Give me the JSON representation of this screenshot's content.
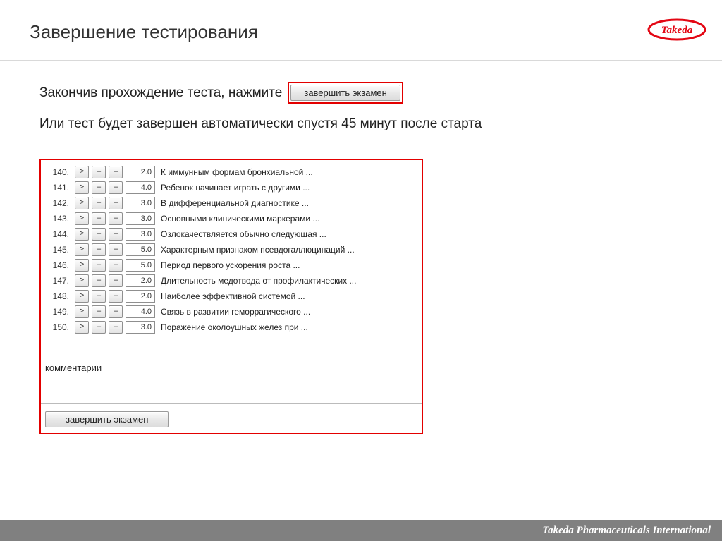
{
  "header": {
    "title": "Завершение тестирования",
    "logo_text": "Takeda",
    "logo_color": "#e30613"
  },
  "intro": {
    "line1_prefix": "Закончив прохождение теста, нажмите",
    "button_label": "завершить экзамен",
    "line2": "Или тест будет завершен автоматически спустя 45 минут после старта"
  },
  "questions": [
    {
      "num": "140.",
      "score": "2.0",
      "text": "К иммунным формам бронхиальной ..."
    },
    {
      "num": "141.",
      "score": "4.0",
      "text": "Ребенок начинает играть с другими ..."
    },
    {
      "num": "142.",
      "score": "3.0",
      "text": "В дифференциальной диагностике ..."
    },
    {
      "num": "143.",
      "score": "3.0",
      "text": "Основными клиническими маркерами ..."
    },
    {
      "num": "144.",
      "score": "3.0",
      "text": "Озлокачествляется обычно следующая ..."
    },
    {
      "num": "145.",
      "score": "5.0",
      "text": "Характерным признаком псевдогаллюцинаций ..."
    },
    {
      "num": "146.",
      "score": "5.0",
      "text": "Период первого ускорения роста ..."
    },
    {
      "num": "147.",
      "score": "2.0",
      "text": "Длительность медотвода от профилактических ..."
    },
    {
      "num": "148.",
      "score": "2.0",
      "text": "Наиболее эффективной системой ..."
    },
    {
      "num": "149.",
      "score": "4.0",
      "text": "Связь в развитии геморрагического ..."
    },
    {
      "num": "150.",
      "score": "3.0",
      "text": "Поражение околоушных желез при ..."
    }
  ],
  "symbols": {
    "chevron": ">",
    "minus": "–"
  },
  "panel": {
    "comments_label": "комментарии",
    "finish_button": "завершить экзамен"
  },
  "footer": {
    "text": "Takeda Pharmaceuticals International"
  }
}
